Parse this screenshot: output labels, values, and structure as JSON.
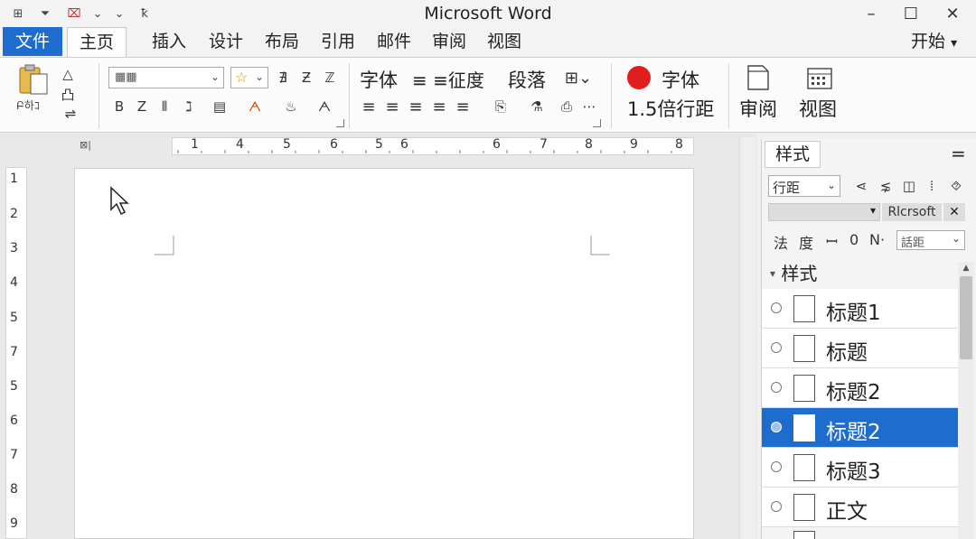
{
  "window": {
    "title": "Microsoft Word",
    "controls": {
      "minimize": "–",
      "maximize": "☐",
      "close": "✕"
    }
  },
  "quick_access": {
    "icons": [
      "table-icon",
      "filter-icon",
      "save-icon",
      "undo-icon",
      "dropdown-icon",
      "pin-icon"
    ],
    "glyphs": [
      "⊞",
      "⏷",
      "⌧",
      "⌄",
      "⌄",
      "ꝁ"
    ]
  },
  "menu": {
    "items": [
      "文件",
      "主页",
      "插入",
      "设计",
      "布局",
      "引用",
      "邮件",
      "审阅",
      "视图"
    ],
    "active": "主页",
    "right_label": "开始",
    "right_arrow": "▾"
  },
  "ribbon": {
    "clipboard": {
      "paste_label": "Բ하ｺ",
      "glyphs": [
        "△",
        "凸",
        "⇌"
      ]
    },
    "font": {
      "font_combo_value": "▦▦",
      "style_combo_value": "☆",
      "row1_glyphs": [
        "∄",
        "Ƶ",
        "ℤ"
      ],
      "row2_glyphs": [
        "Β",
        "Ζ",
        "⫴",
        "ℷ",
        "▤",
        "ᗅ",
        "♨",
        "ᗅ"
      ]
    },
    "paragraph": {
      "labels": [
        "字体",
        "≡ ≡征度",
        "段落"
      ],
      "row2_glyphs": [
        "≡",
        "≡",
        "≡",
        "≡",
        "≡",
        "⎘",
        "⚗",
        "⎙",
        "⋯"
      ]
    },
    "styles": {
      "font_label": "字体",
      "spacing_label": "1.5倍行距",
      "record_color": "#e01e1e"
    },
    "review": {
      "label": "审阅"
    },
    "view": {
      "label": "视图"
    }
  },
  "ruler": {
    "horizontal": [
      "1",
      "4",
      "5",
      "6",
      "5",
      "6",
      "6",
      "7",
      "8",
      "9",
      "8"
    ],
    "vertical": [
      "1",
      "2",
      "3",
      "4",
      "5",
      "7",
      "5",
      "6",
      "7",
      "8",
      "9"
    ],
    "corner_glyph": "⊠|"
  },
  "styles_pane": {
    "tab_label": "样式",
    "menu_glyph": "=",
    "row1": {
      "combo_value": "行距",
      "glyphs": [
        "⋖",
        "⋦",
        "◫",
        "⦙",
        "⯑"
      ]
    },
    "row2": {
      "combo_label": "Rlcrsoft",
      "close": "✕"
    },
    "row3": {
      "labels": [
        "法",
        "度",
        "ꟷ",
        "0",
        "N·"
      ],
      "combo_value": "話距"
    },
    "section_label": "样式",
    "items": [
      {
        "label": "标题1",
        "selected": false
      },
      {
        "label": "标题",
        "selected": false
      },
      {
        "label": "标题2",
        "selected": false
      },
      {
        "label": "标题2",
        "selected": true
      },
      {
        "label": "标题3",
        "selected": false
      },
      {
        "label": "正文",
        "selected": false
      }
    ]
  }
}
